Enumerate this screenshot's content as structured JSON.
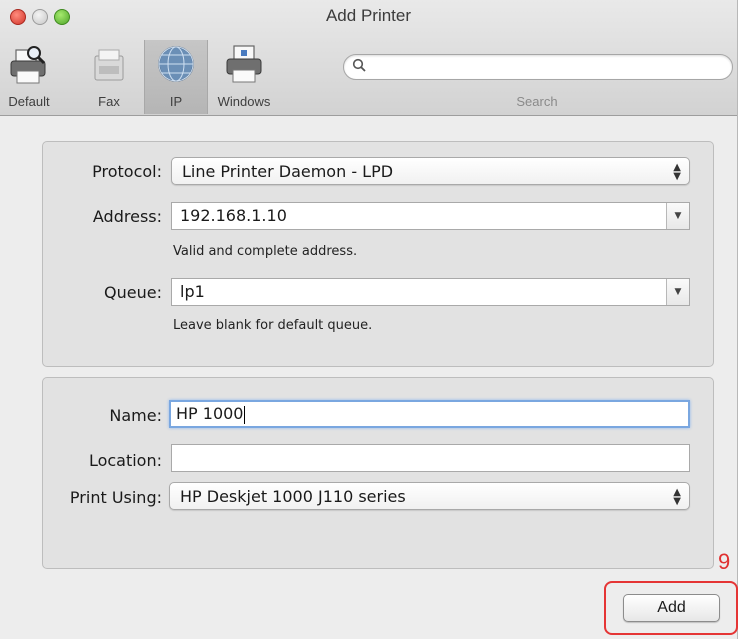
{
  "window": {
    "title": "Add Printer"
  },
  "toolbar": {
    "items": [
      {
        "label": "Default",
        "icon": "printer-magnifier-icon"
      },
      {
        "label": "Fax",
        "icon": "fax-icon"
      },
      {
        "label": "IP",
        "icon": "globe-icon",
        "selected": true
      },
      {
        "label": "Windows",
        "icon": "windows-printer-icon"
      }
    ],
    "search": {
      "label": "Search",
      "value": "",
      "placeholder": ""
    }
  },
  "connection": {
    "protocol": {
      "label": "Protocol:",
      "value": "Line Printer Daemon - LPD"
    },
    "address": {
      "label": "Address:",
      "value": "192.168.1.10",
      "hint": "Valid and complete address."
    },
    "queue": {
      "label": "Queue:",
      "value": "lp1",
      "hint": "Leave blank for default queue."
    }
  },
  "details": {
    "name": {
      "label": "Name:",
      "value": "HP 1000"
    },
    "location": {
      "label": "Location:",
      "value": ""
    },
    "print_using": {
      "label": "Print Using:",
      "value": "HP Deskjet 1000 J110 series"
    }
  },
  "footer": {
    "add_label": "Add",
    "step_number": "9",
    "callout_color": "#e53535"
  }
}
